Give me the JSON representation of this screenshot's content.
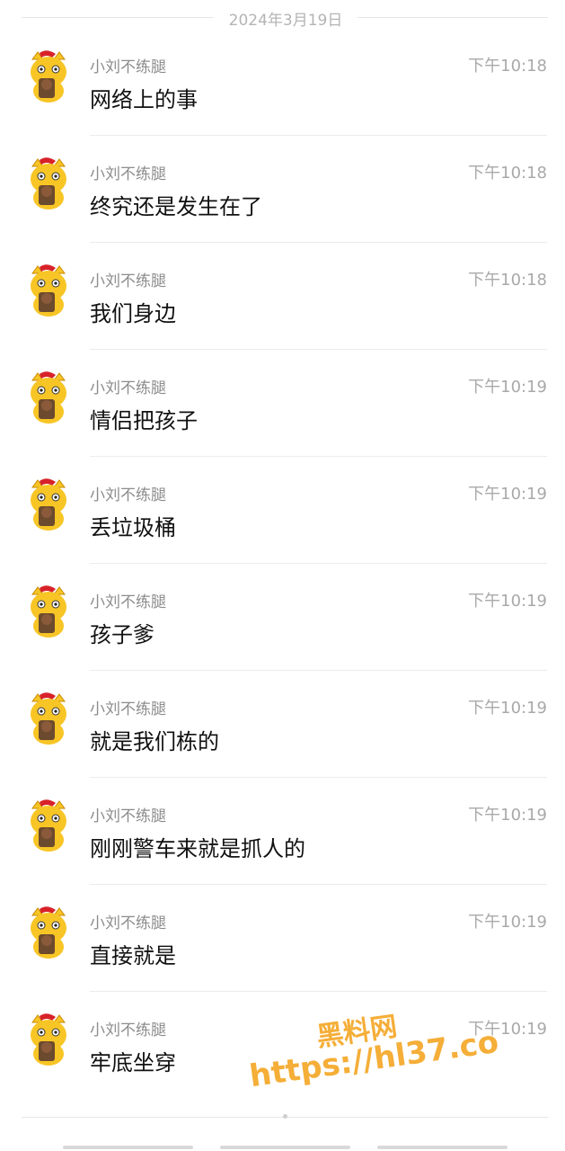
{
  "date_divider": "2024年3月19日",
  "messages": [
    {
      "sender": "小刘不练腿",
      "time": "下午10:18",
      "text": "网络上的事"
    },
    {
      "sender": "小刘不练腿",
      "time": "下午10:18",
      "text": "终究还是发生在了"
    },
    {
      "sender": "小刘不练腿",
      "time": "下午10:18",
      "text": "我们身边"
    },
    {
      "sender": "小刘不练腿",
      "time": "下午10:19",
      "text": "情侣把孩子"
    },
    {
      "sender": "小刘不练腿",
      "time": "下午10:19",
      "text": "丢垃圾桶"
    },
    {
      "sender": "小刘不练腿",
      "time": "下午10:19",
      "text": "孩子爹"
    },
    {
      "sender": "小刘不练腿",
      "time": "下午10:19",
      "text": "就是我们栋的"
    },
    {
      "sender": "小刘不练腿",
      "time": "下午10:19",
      "text": "刚刚警车来就是抓人的"
    },
    {
      "sender": "小刘不练腿",
      "time": "下午10:19",
      "text": "直接就是"
    },
    {
      "sender": "小刘不练腿",
      "time": "下午10:19",
      "text": "牢底坐穿"
    }
  ],
  "watermark": {
    "title": "黑料网",
    "url": "https://hl37.co"
  },
  "colors": {
    "avatar_yellow": "#f7c525",
    "watermark_orange": "#f5a623"
  },
  "icons": {
    "avatar": "cartoon-cat-avatar"
  }
}
